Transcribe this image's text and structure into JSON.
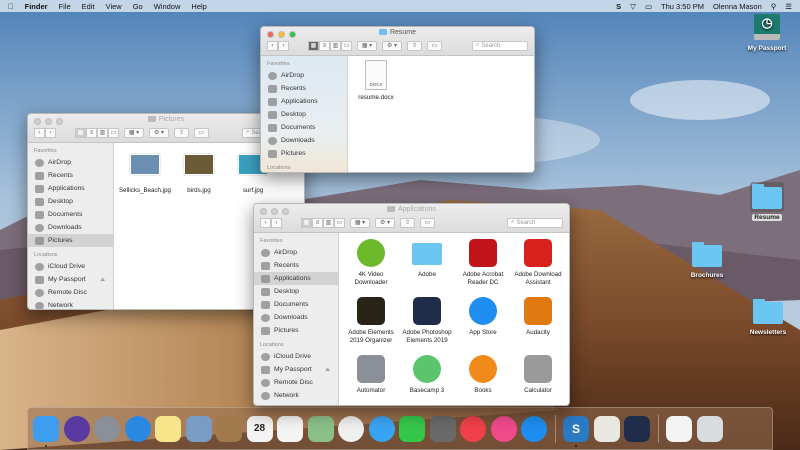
{
  "menubar": {
    "apple_icon": "apple-icon",
    "app": "Finder",
    "items": [
      "File",
      "Edit",
      "View",
      "Go",
      "Window",
      "Help"
    ],
    "clock": "Thu 3:50 PM",
    "user": "Olenna Mason"
  },
  "desktop": {
    "icons": [
      {
        "label": "My Passport",
        "icon": "external-drive-icon"
      },
      {
        "label": "Resume",
        "icon": "folder-icon",
        "selected": true
      },
      {
        "label": "Brochures",
        "icon": "folder-icon"
      },
      {
        "label": "Newsletters",
        "icon": "folder-icon"
      }
    ]
  },
  "windows": {
    "pictures": {
      "title": "Pictures",
      "search_placeholder": "Search",
      "favorites_label": "Favorites",
      "locations_label": "Locations",
      "favorites": [
        "AirDrop",
        "Recents",
        "Applications",
        "Desktop",
        "Documents",
        "Downloads",
        "Pictures"
      ],
      "locations": [
        "iCloud Drive",
        "My Passport",
        "Remote Disc",
        "Network"
      ],
      "selected": "Pictures",
      "files": [
        {
          "name": "Sellicks_Beach.jpg",
          "color": "#6a8fb0"
        },
        {
          "name": "birds.jpg",
          "color": "#6b5a36"
        },
        {
          "name": "surf.jpg",
          "color": "#3aa0c0"
        }
      ]
    },
    "resume": {
      "title": "Resume",
      "search_placeholder": "Search",
      "favorites_label": "Favorites",
      "locations_label": "Locations",
      "favorites": [
        "AirDrop",
        "Recents",
        "Applications",
        "Desktop",
        "Documents",
        "Downloads",
        "Pictures"
      ],
      "locations": [],
      "files": [
        {
          "name": "resume.docx",
          "doc_label": "DOCX"
        }
      ]
    },
    "applications": {
      "title": "Applications",
      "search_placeholder": "Search",
      "favorites_label": "Favorites",
      "locations_label": "Locations",
      "favorites": [
        "AirDrop",
        "Recents",
        "Applications",
        "Desktop",
        "Documents",
        "Downloads",
        "Pictures"
      ],
      "locations": [
        "iCloud Drive",
        "My Passport",
        "Remote Disc",
        "Network"
      ],
      "selected": "Applications",
      "files": [
        {
          "name": "4K Video Downloader",
          "color": "#6cba2c"
        },
        {
          "name": "Adobe",
          "color": "#6cc6f4"
        },
        {
          "name": "Adobe Acrobat Reader DC",
          "color": "#c0141a"
        },
        {
          "name": "Adobe Download Assistant",
          "color": "#d8201c"
        },
        {
          "name": "Adobe Elements 2019 Organizer",
          "color": "#2a2418"
        },
        {
          "name": "Adobe Photoshop Elements 2019",
          "color": "#1f2d4a"
        },
        {
          "name": "App Store",
          "color": "#1e8ef0"
        },
        {
          "name": "Audacity",
          "color": "#e07a10"
        },
        {
          "name": "Automator",
          "color": "#8a8f98"
        },
        {
          "name": "Basecamp 3",
          "color": "#5cc46c"
        },
        {
          "name": "Books",
          "color": "#f08a1a"
        },
        {
          "name": "Calculator",
          "color": "#9a9a9a"
        }
      ]
    }
  },
  "dock": {
    "items": [
      {
        "icon": "finder-icon",
        "color": "#3d9df0",
        "running": true
      },
      {
        "icon": "siri-icon",
        "color": "#5a3aa0"
      },
      {
        "icon": "launchpad-icon",
        "color": "#8a8f98"
      },
      {
        "icon": "safari-icon",
        "color": "#2a88e0"
      },
      {
        "icon": "notes-icon",
        "color": "#f6e58a"
      },
      {
        "icon": "preview-icon",
        "color": "#7a9cc4"
      },
      {
        "icon": "contacts-icon",
        "color": "#a07a4a"
      },
      {
        "icon": "calendar-icon",
        "color": "#f4f4f4",
        "text": "28"
      },
      {
        "icon": "reminders-icon",
        "color": "#f4f4f4"
      },
      {
        "icon": "maps-icon",
        "color": "#8cc08a"
      },
      {
        "icon": "photos-icon",
        "color": "#f0f0f0"
      },
      {
        "icon": "messages-icon",
        "color": "#3aa4f4"
      },
      {
        "icon": "facetime-icon",
        "color": "#34c84a"
      },
      {
        "icon": "system-preferences-icon",
        "color": "#6a6a6a"
      },
      {
        "icon": "news-icon",
        "color": "#f0404a"
      },
      {
        "icon": "itunes-icon",
        "color": "#f04a8a"
      },
      {
        "icon": "app-store-icon",
        "color": "#1e8ef0"
      },
      {
        "sep": true
      },
      {
        "icon": "snagit-icon",
        "color": "#2a7ac4",
        "text": "S",
        "running": true
      },
      {
        "icon": "textedit-icon",
        "color": "#e8e8e0"
      },
      {
        "icon": "photoshop-elements-icon",
        "color": "#1f2d4a"
      },
      {
        "sep": true
      },
      {
        "icon": "document-icon",
        "color": "#f4f4f4"
      },
      {
        "icon": "trash-icon",
        "color": "#d8dcdf"
      }
    ]
  }
}
